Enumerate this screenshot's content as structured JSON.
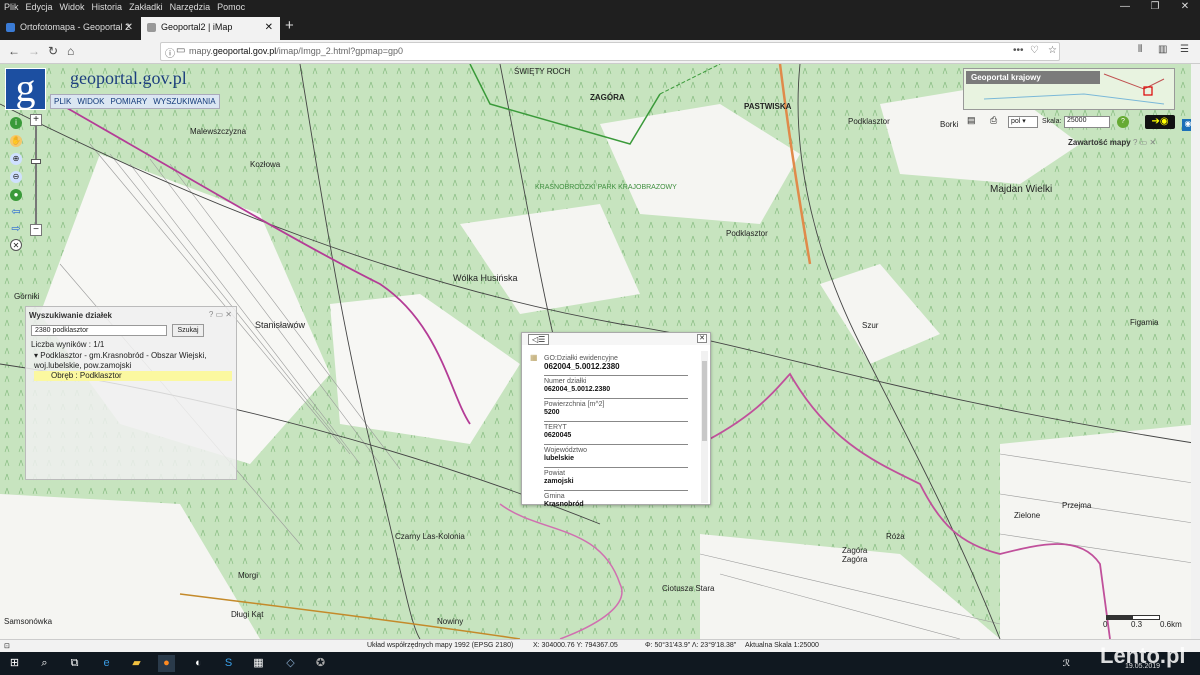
{
  "menu": [
    "Plik",
    "Edycja",
    "Widok",
    "Historia",
    "Zakładki",
    "Narzędzia",
    "Pomoc"
  ],
  "tabs": [
    {
      "label": "Ortofotomapa - Geoportal 2"
    },
    {
      "label": "Geoportal2 | iMap"
    }
  ],
  "url": {
    "prefix": "mapy.",
    "domain": "geoportal.gov.pl",
    "path": "/imap/Imgp_2.html?gpmap=gp0"
  },
  "site": {
    "logo_letter": "g",
    "name": "geoportal.gov.pl"
  },
  "map_menu": [
    "PLIK",
    "WIDOK",
    "POMIARY",
    "WYSZUKIWANIA"
  ],
  "overview": {
    "title": "Geoportal krajowy"
  },
  "toolbar": {
    "lang": "pol",
    "scale_label": "Skala:",
    "scale_value": "25000"
  },
  "legend_header": "Zawartość mapy",
  "places": [
    {
      "name": "ŚWIĘTY ROCH"
    },
    {
      "name": "ZAGÓRA"
    },
    {
      "name": "PASTWISKA"
    },
    {
      "name": "Malewszczyzna"
    },
    {
      "name": "Kozłowa"
    },
    {
      "name": "Podklasztor"
    },
    {
      "name": "Borki"
    },
    {
      "name": "Majdan Wielki"
    },
    {
      "name": "KRASNOBRODZKI PARK KRAJOBRAZOWY"
    },
    {
      "name": "Podklasztor"
    },
    {
      "name": "Wólka Husińska"
    },
    {
      "name": "Górniki"
    },
    {
      "name": "Stanisławów"
    },
    {
      "name": "Szur"
    },
    {
      "name": "Figamia"
    },
    {
      "name": "Zielone"
    },
    {
      "name": "Przejma"
    },
    {
      "name": "Róża"
    },
    {
      "name": "Zagóra"
    },
    {
      "name": "Zagóra"
    },
    {
      "name": "Czarny Las-Kolonia"
    },
    {
      "name": "Ciotusza Stara"
    },
    {
      "name": "Morgi"
    },
    {
      "name": "Długi Kąt"
    },
    {
      "name": "Samsonówka"
    },
    {
      "name": "Nowiny"
    }
  ],
  "search_panel": {
    "title": "Wyszukiwanie działek",
    "query": "2380 podklasztor",
    "button": "Szukaj",
    "count": "Liczba wyników : 1/1",
    "result": "Podklasztor - gm.Krasnobród - Obszar Wiejski, woj.lubelskie, pow.zamojski",
    "sub": "Obręb : Podklasztor"
  },
  "popup": {
    "fields": [
      {
        "label": "GO:Działki ewidencyjne",
        "value": "062004_5.0012.2380"
      },
      {
        "label": "Numer działki",
        "value": "062004_5.0012.2380"
      },
      {
        "label": "Powierzchnia [m^2]",
        "value": "5200"
      },
      {
        "label": "TERYT",
        "value": "0620045"
      },
      {
        "label": "Województwo",
        "value": "lubelskie"
      },
      {
        "label": "Powiat",
        "value": "zamojski"
      },
      {
        "label": "Gmina",
        "value": "Krasnobród"
      }
    ]
  },
  "scale_bar": {
    "l0": "0",
    "l1": "0.3",
    "l2": "0.6km"
  },
  "status": {
    "crs": "Układ współrzędnych mapy 1992 (EPSG 2180)",
    "xy": "X: 304000.76 Y: 794367.05",
    "geo": "Φ: 50°31'43.9\" Λ: 23°9'18.38\"",
    "scale": "Aktualna Skala 1:25000"
  },
  "clock": "19.05.2019",
  "watermark": "Lento.pl"
}
